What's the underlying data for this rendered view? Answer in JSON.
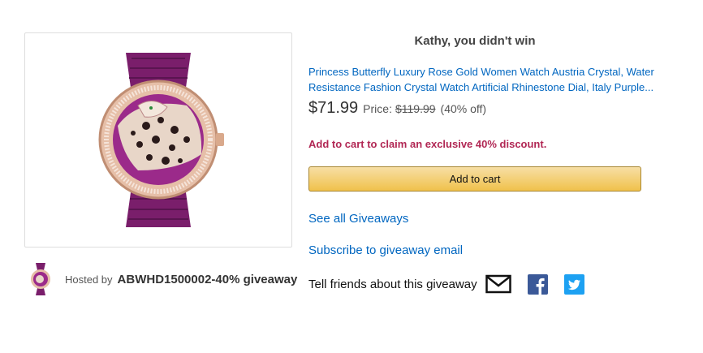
{
  "result": {
    "title": "Kathy, you didn't win"
  },
  "product": {
    "name": "Princess Butterfly Luxury Rose Gold Women Watch Austria Crystal, Water Resistance Fashion Crystal Watch Artificial Rhinestone Dial, Italy Purple...",
    "price_current": "$71.99",
    "price_label": "Price:",
    "price_old": "$119.99",
    "discount": "(40% off)",
    "image_icon": "watch-image",
    "colors": {
      "strap": "#7a1e6b",
      "case": "#d9a98c",
      "dial": "#9b2a8a"
    }
  },
  "promo": {
    "text": "Add to cart to claim an exclusive 40% discount."
  },
  "cart": {
    "button_label": "Add to cart"
  },
  "links": {
    "see_all": "See all Giveaways",
    "subscribe": "Subscribe to giveaway email"
  },
  "host": {
    "hosted_by_label": "Hosted by",
    "name": "ABWHD1500002-40% giveaway"
  },
  "share": {
    "label": "Tell friends about this giveaway",
    "icons": [
      "mail-icon",
      "facebook-icon",
      "twitter-icon"
    ],
    "colors": {
      "facebook": "#3b5998",
      "twitter": "#1da1f2"
    }
  }
}
